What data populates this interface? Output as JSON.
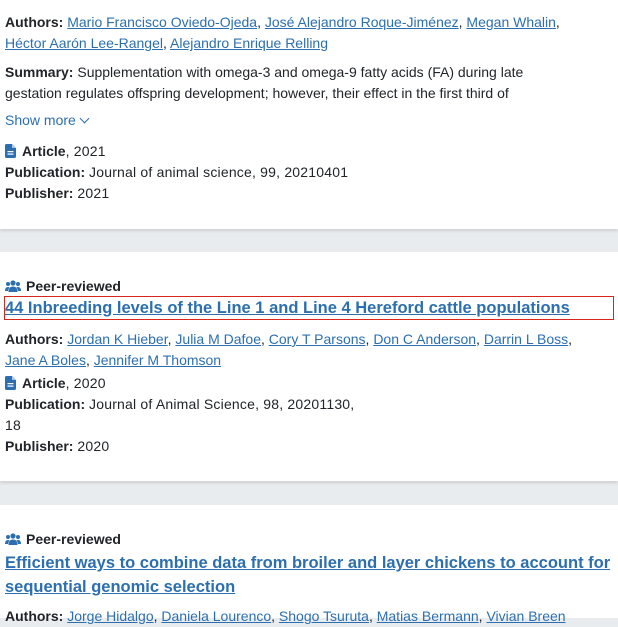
{
  "card1": {
    "authors_label": "Authors:",
    "authors_line1": [
      "Mario Francisco Oviedo-Ojeda",
      "José Alejandro Roque-Jiménez",
      "Megan Whalin"
    ],
    "authors_line2": [
      "Héctor Aarón Lee-Rangel",
      "Alejandro Enrique Relling"
    ],
    "summary_label": "Summary:",
    "summary_line1": "Supplementation with omega-3 and omega-9 fatty acids (FA) during late",
    "summary_line2": "gestation regulates offspring development; however, their effect in the first third of",
    "show_more": "Show more",
    "type_label": "Article",
    "year": ", 2021",
    "publication_label": "Publication:",
    "publication": "Journal of animal science, 99, 20210401",
    "publisher_label": "Publisher:",
    "publisher": "2021"
  },
  "card2": {
    "peer_label": "Peer-reviewed",
    "title": "44 Inbreeding levels of the Line 1 and Line 4 Hereford cattle populations",
    "authors_label": "Authors:",
    "authors_line1": [
      "Jordan K Hieber",
      "Julia M Dafoe",
      "Cory T Parsons",
      "Don C Anderson",
      "Darrin L Boss"
    ],
    "authors_line2": [
      "Jane A Boles",
      "Jennifer M Thomson"
    ],
    "type_label": "Article",
    "year": ", 2020",
    "publication_label": "Publication:",
    "publication": "Journal of Animal Science, 98, 20201130,",
    "publication_cont": "18",
    "publisher_label": "Publisher:",
    "publisher": "2020"
  },
  "card3": {
    "peer_label": "Peer-reviewed",
    "title_line1": "Efficient ways to combine data from broiler and layer chickens to account for",
    "title_line2": "sequential genomic selection",
    "authors_label": "Authors:",
    "authors_line1": [
      "Jorge Hidalgo",
      "Daniela Lourenco",
      "Shogo Tsuruta",
      "Matias Bermann",
      "Vivian Breen"
    ]
  },
  "colors": {
    "link": "#2c6fb0",
    "highlight_border": "#d9261c",
    "background": "#e9ecef"
  }
}
